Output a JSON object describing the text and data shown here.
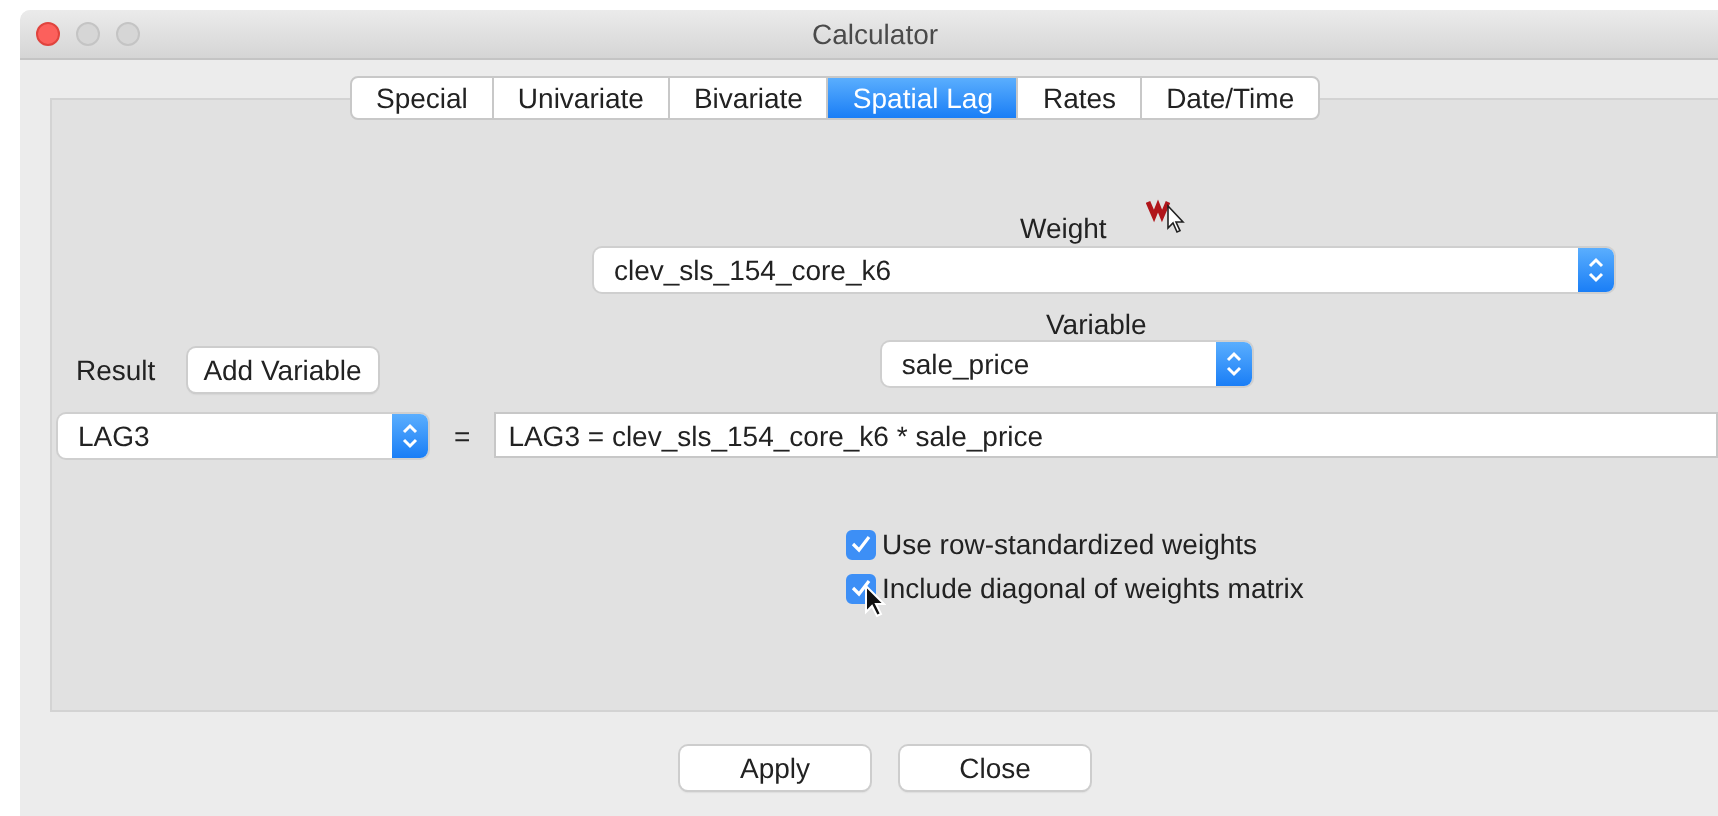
{
  "window": {
    "title": "Calculator"
  },
  "tabs": [
    {
      "label": "Special",
      "selected": false
    },
    {
      "label": "Univariate",
      "selected": false
    },
    {
      "label": "Bivariate",
      "selected": false
    },
    {
      "label": "Spatial Lag",
      "selected": true
    },
    {
      "label": "Rates",
      "selected": false
    },
    {
      "label": "Date/Time",
      "selected": false
    }
  ],
  "weight": {
    "label": "Weight",
    "value": "clev_sls_154_core_k6"
  },
  "variable": {
    "label": "Variable",
    "value": "sale_price"
  },
  "result": {
    "label": "Result",
    "add_button": "Add Variable",
    "value": "LAG3"
  },
  "equals": "=",
  "formula": "LAG3 = clev_sls_154_core_k6 * sale_price",
  "options": [
    {
      "label": "Use row-standardized weights",
      "checked": true
    },
    {
      "label": "Include diagonal of weights matrix",
      "checked": true
    }
  ],
  "buttons": [
    "Apply",
    "Close"
  ]
}
